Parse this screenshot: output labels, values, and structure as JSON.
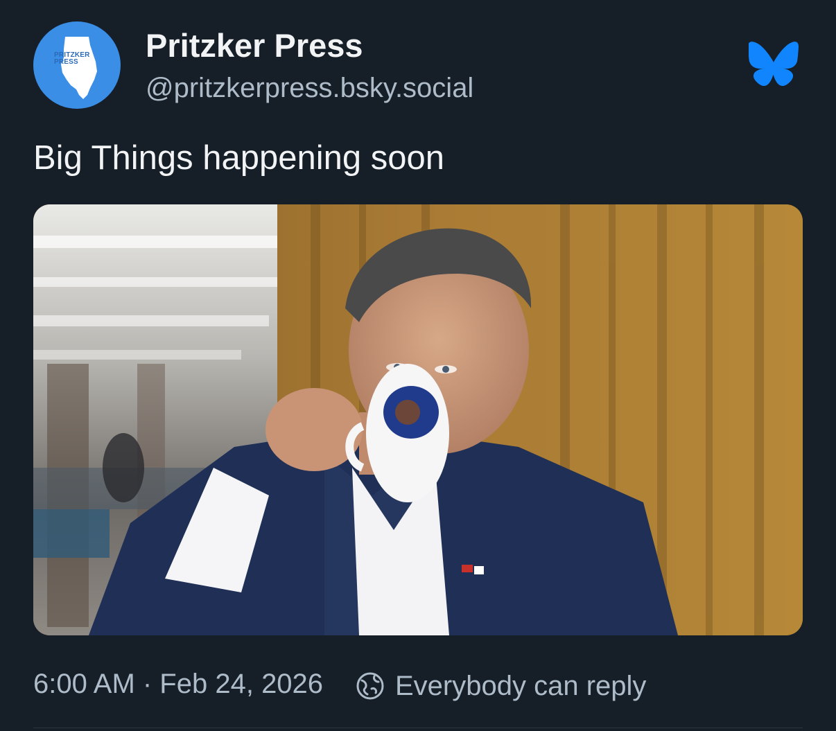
{
  "author": {
    "display_name": "Pritzker Press",
    "handle": "@pritzkerpress.bsky.social",
    "avatar_text_line1": "PRITZKER",
    "avatar_text_line2": "PRESS"
  },
  "post": {
    "text": "Big Things happening soon",
    "image_icon": "photo-of-man-drinking-from-mug"
  },
  "footer": {
    "timestamp": "6:00 AM · Feb 24, 2026",
    "reply_setting": "Everybody can reply",
    "reply_icon": "globe-icon"
  },
  "colors": {
    "background": "#161e27",
    "text_primary": "#f1f3f5",
    "text_secondary": "#aebbc9",
    "brand_blue": "#1185fe",
    "avatar_blue": "#3a8ee6"
  }
}
